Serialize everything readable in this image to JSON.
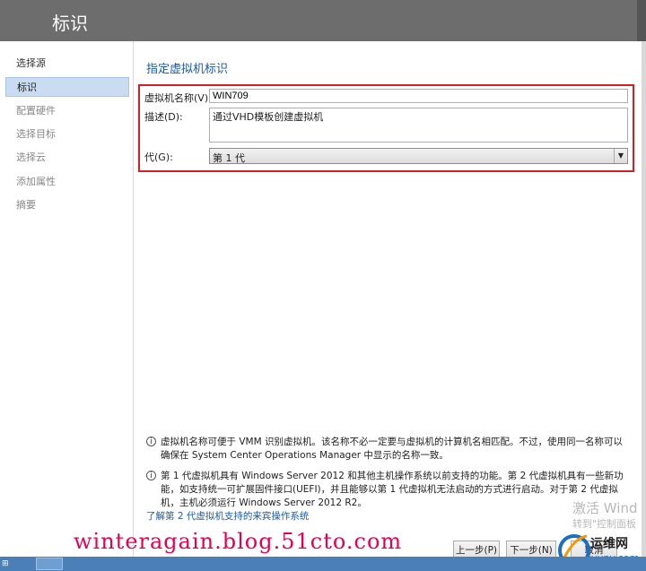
{
  "window": {
    "title": "标识"
  },
  "sidebar": {
    "items": [
      {
        "label": "选择源",
        "state": "done"
      },
      {
        "label": "标识",
        "state": "active"
      },
      {
        "label": "配置硬件",
        "state": "pending"
      },
      {
        "label": "选择目标",
        "state": "pending"
      },
      {
        "label": "选择云",
        "state": "pending"
      },
      {
        "label": "添加属性",
        "state": "pending"
      },
      {
        "label": "摘要",
        "state": "pending"
      }
    ]
  },
  "main": {
    "heading": "指定虚拟机标识",
    "name_label": "虚拟机名称(V):",
    "name_value": "WIN709",
    "desc_label": "描述(D):",
    "desc_value": "通过VHD模板创建虚拟机",
    "gen_label": "代(G):",
    "gen_value": "第 1 代"
  },
  "info": {
    "note1": "虚拟机名称可便于 VMM 识别虚拟机。该名称不必一定要与虚拟机的计算机名相匹配。不过，使用同一名称可以确保在 System Center Operations Manager 中显示的名称一致。",
    "note2": "第 1 代虚拟机具有 Windows Server 2012 和其他主机操作系统以前支持的功能。第 2 代虚拟机具有一些新功能，如支持统一可扩展固件接口(UEFI)，并且能够以第 1 代虚拟机无法启动的方式进行启动。对于第 2 代虚拟机，主机必须运行 Windows Server 2012 R2。",
    "link": "了解第 2 代虚拟机支持的来宾操作系统"
  },
  "buttons": {
    "prev": "上一步(P)",
    "next": "下一步(N)",
    "cancel": "取消"
  },
  "overlay": {
    "watermark": "winteragain.blog.51cto.com",
    "activation_line1": "激活 Wind",
    "activation_line2": "转到\"控制面板",
    "logo_text": "运维网",
    "logo_url": "iyunv.com"
  }
}
